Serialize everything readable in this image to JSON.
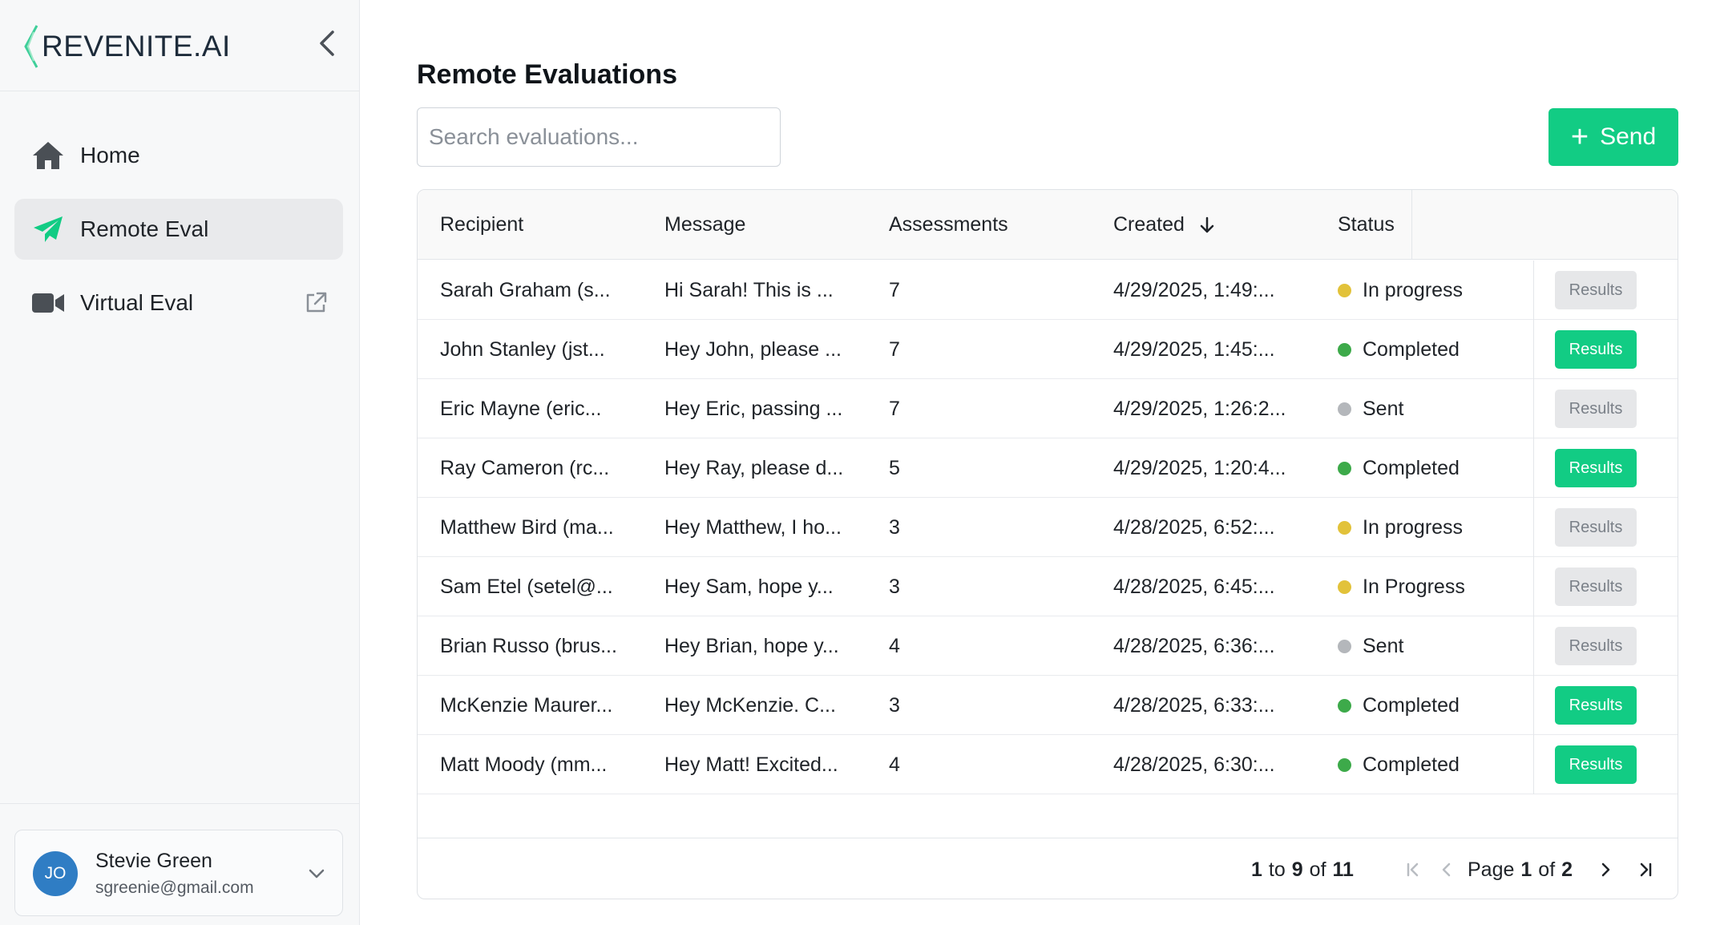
{
  "sidebar": {
    "brand": "REVENITE.AI",
    "nav": [
      {
        "label": "Home",
        "icon": "home-icon",
        "active": false
      },
      {
        "label": "Remote Eval",
        "icon": "paper-plane-icon",
        "active": true
      },
      {
        "label": "Virtual Eval",
        "icon": "video-camera-icon",
        "active": false
      }
    ],
    "user": {
      "initials": "JO",
      "name": "Stevie Green",
      "email": "sgreenie@gmail.com"
    }
  },
  "main": {
    "title": "Remote Evaluations",
    "search": {
      "placeholder": "Search evaluations...",
      "value": ""
    },
    "send_label": "Send",
    "table": {
      "columns": [
        "Recipient",
        "Message",
        "Assessments",
        "Created",
        "Status"
      ],
      "sort_column": "Created",
      "action_label": "Results",
      "rows": [
        {
          "recipient": "Sarah Graham (s...",
          "message": "Hi Sarah! This is ...",
          "assessments": "7",
          "created": "4/29/2025, 1:49:...",
          "status": "In progress",
          "status_color": "#e2c23a",
          "results_enabled": false
        },
        {
          "recipient": "John Stanley (jst...",
          "message": "Hey John, please ...",
          "assessments": "7",
          "created": "4/29/2025, 1:45:...",
          "status": "Completed",
          "status_color": "#3daa4a",
          "results_enabled": true
        },
        {
          "recipient": "Eric Mayne (eric...",
          "message": "Hey Eric, passing ...",
          "assessments": "7",
          "created": "4/29/2025, 1:26:2...",
          "status": "Sent",
          "status_color": "#b4b7bb",
          "results_enabled": false
        },
        {
          "recipient": "Ray Cameron (rc...",
          "message": "Hey Ray, please d...",
          "assessments": "5",
          "created": "4/29/2025, 1:20:4...",
          "status": "Completed",
          "status_color": "#3daa4a",
          "results_enabled": true
        },
        {
          "recipient": "Matthew Bird (ma...",
          "message": "Hey Matthew, I ho...",
          "assessments": "3",
          "created": "4/28/2025, 6:52:...",
          "status": "In progress",
          "status_color": "#e2c23a",
          "results_enabled": false
        },
        {
          "recipient": "Sam Etel (setel@...",
          "message": "Hey Sam, hope y...",
          "assessments": "3",
          "created": "4/28/2025, 6:45:...",
          "status": "In Progress",
          "status_color": "#e2c23a",
          "results_enabled": false
        },
        {
          "recipient": "Brian Russo (brus...",
          "message": "Hey Brian, hope y...",
          "assessments": "4",
          "created": "4/28/2025, 6:36:...",
          "status": "Sent",
          "status_color": "#b4b7bb",
          "results_enabled": false
        },
        {
          "recipient": "McKenzie Maurer...",
          "message": "Hey McKenzie. C...",
          "assessments": "3",
          "created": "4/28/2025, 6:33:...",
          "status": "Completed",
          "status_color": "#3daa4a",
          "results_enabled": true
        },
        {
          "recipient": "Matt Moody (mm...",
          "message": "Hey Matt! Excited...",
          "assessments": "4",
          "created": "4/28/2025, 6:30:...",
          "status": "Completed",
          "status_color": "#3daa4a",
          "results_enabled": true
        }
      ]
    },
    "pagination": {
      "range_start": "1",
      "range_end": "9",
      "total": "11",
      "range_to": "to",
      "range_of": "of",
      "page_word": "Page",
      "page_of_word": "of",
      "current_page": "1",
      "total_pages": "2"
    }
  },
  "colors": {
    "accent": "#12cc84",
    "avatar": "#2f7dc4"
  }
}
